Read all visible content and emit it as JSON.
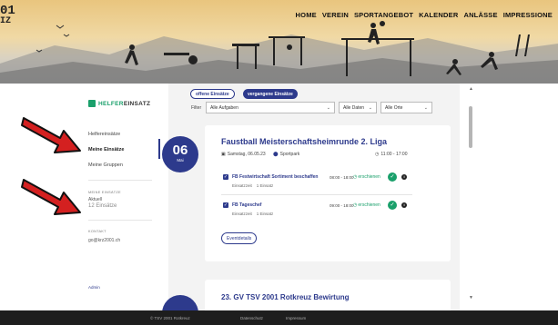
{
  "header": {
    "logo_fragment_top": "01",
    "logo_fragment_bottom": "IZ",
    "nav": [
      "HOME",
      "VEREIN",
      "SPORTANGEBOT",
      "KALENDER",
      "ANLÄSSE",
      "IMPRESSIONE"
    ]
  },
  "sidebar": {
    "brand_part1": "HELFER",
    "brand_part2": "EINSATZ",
    "links": [
      "Helfereinsätze",
      "Meine Einsätze",
      "Meine Gruppen"
    ],
    "active_index": 1,
    "stats_label": "MEINE EINSÄTZE",
    "stats_sublabel": "Aktuell",
    "stats_value": "12 Einsätze",
    "contact_label": "KONTAKT",
    "contact_value": "go@krz2001.ch",
    "more_link": "Admin"
  },
  "filters": {
    "tab_open": "offene Einsätze",
    "tab_past": "vergangene Einsätze",
    "filter_label": "Filter",
    "tasks_select": "Alle Aufgaben",
    "dates_select": "Alle Daten",
    "places_select": "Alle Orte"
  },
  "event1": {
    "day": "06",
    "month": "Mai",
    "title": "Faustball Meisterschaftsheimrunde 2. Liga",
    "date": "Samstag, 06.05.23",
    "location": "Sportpark",
    "time": "11:00 - 17:00",
    "tasks": [
      {
        "title": "FB Festwirtschaft Sortiment beschaffen",
        "subtitle_label": "Einsatzzeit",
        "subtitle_value": "1 Einsatz",
        "time": "08:00 - 18:00",
        "status": "erschienen"
      },
      {
        "title": "FB Tageschef",
        "subtitle_label": "Einsatzzeit",
        "subtitle_value": "1 Einsatz",
        "time": "09:00 - 18:00",
        "status": "erschienen"
      }
    ],
    "details_button": "Eventdetails"
  },
  "event2": {
    "title": "23. GV TSV 2001 Rotkreuz Bewirtung"
  },
  "footer": {
    "copyright": "© TSV 2001 Rotkreuz",
    "privacy": "Datenschutz",
    "imprint": "Impressum"
  },
  "colors": {
    "primary": "#2d3a8c",
    "success": "#1aa06b",
    "arrow": "#d42020",
    "footer": "#1e1e1e"
  }
}
